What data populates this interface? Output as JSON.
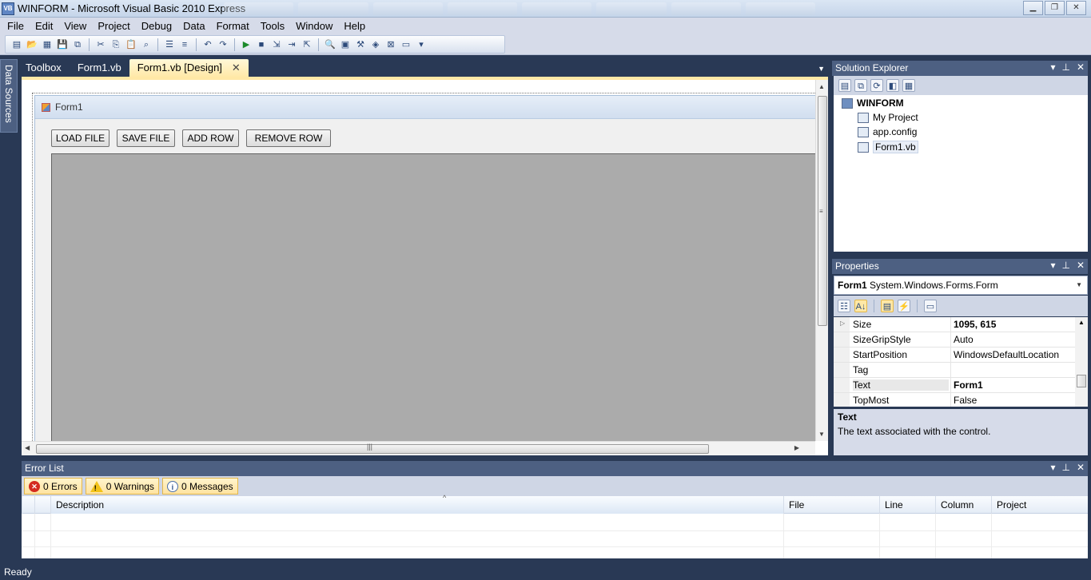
{
  "window": {
    "title": "WINFORM - Microsoft Visual Basic 2010 Express",
    "app_icon": "VB",
    "controls": [
      "minimize-icon",
      "restore-icon",
      "close-icon"
    ]
  },
  "menu": [
    "File",
    "Edit",
    "View",
    "Project",
    "Debug",
    "Data",
    "Format",
    "Tools",
    "Window",
    "Help"
  ],
  "left_rail": {
    "label": "Data Sources"
  },
  "doc_tabs": [
    {
      "label": "Toolbox",
      "active": false
    },
    {
      "label": "Form1.vb",
      "active": false
    },
    {
      "label": "Form1.vb [Design]",
      "active": true
    }
  ],
  "designer": {
    "form_title": "Form1",
    "buttons": [
      "LOAD FILE",
      "SAVE FILE",
      "ADD ROW",
      "REMOVE ROW"
    ]
  },
  "solution_explorer": {
    "title": "Solution Explorer",
    "root": "WINFORM",
    "items": [
      "My Project",
      "app.config",
      "Form1.vb"
    ],
    "selected": "Form1.vb"
  },
  "properties": {
    "title": "Properties",
    "object_name": "Form1",
    "object_type": "System.Windows.Forms.Form",
    "rows": [
      {
        "name": "Size",
        "value": "1095, 615",
        "bold": true,
        "expandable": true
      },
      {
        "name": "SizeGripStyle",
        "value": "Auto"
      },
      {
        "name": "StartPosition",
        "value": "WindowsDefaultLocation"
      },
      {
        "name": "Tag",
        "value": ""
      },
      {
        "name": "Text",
        "value": "Form1",
        "bold": true
      },
      {
        "name": "TopMost",
        "value": "False"
      }
    ],
    "selected_row": "Text",
    "description_title": "Text",
    "description_text": "The text associated with the control."
  },
  "error_list": {
    "title": "Error List",
    "filters": [
      {
        "icon": "error-icon",
        "label": "0 Errors"
      },
      {
        "icon": "warning-icon",
        "label": "0 Warnings"
      },
      {
        "icon": "info-icon",
        "label": "0 Messages"
      }
    ],
    "columns": [
      "Description",
      "File",
      "Line",
      "Column",
      "Project"
    ],
    "sorted_column": "Description"
  },
  "status": {
    "text": "Ready"
  },
  "colors": {
    "chrome": "#293955",
    "tool_header": "#4d6082",
    "active_tab": "#ffe9a8",
    "grid_background": "#ababab"
  }
}
